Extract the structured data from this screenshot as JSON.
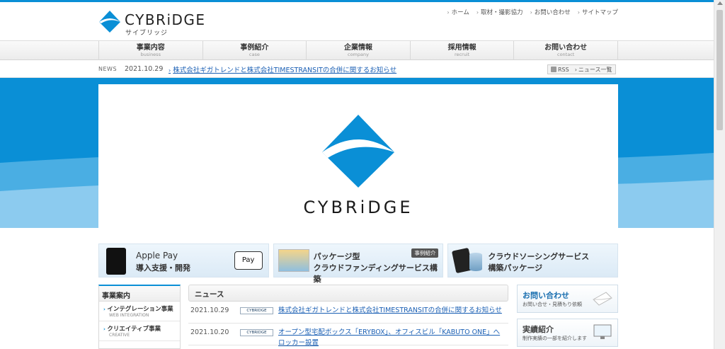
{
  "header": {
    "logo_text": "CYBRiDGE",
    "logo_sub": "サイブリッジ",
    "util_nav": [
      "ホーム",
      "取材・撮影協力",
      "お問い合わせ",
      "サイトマップ"
    ]
  },
  "gnav": [
    {
      "jp": "事業内容",
      "en": "business"
    },
    {
      "jp": "事例紹介",
      "en": "case"
    },
    {
      "jp": "企業情報",
      "en": "company"
    },
    {
      "jp": "採用情報",
      "en": "recruit"
    },
    {
      "jp": "お問い合わせ",
      "en": "contact"
    }
  ],
  "newsbar": {
    "label": "NEWS",
    "date": "2021.10.29",
    "title": "株式会社ギガトレンドと株式会社TIMESTRANSITの合併に関するお知らせ",
    "rss": "RSS",
    "list": "ニュース一覧"
  },
  "hero": {
    "logo_text": "CYBRiDGE"
  },
  "banners": {
    "b1": {
      "line1": "Apple Pay",
      "line2": "導入支援・開発",
      "pay": " Pay"
    },
    "b2": {
      "line1": "パッケージ型",
      "line2": "クラウドファンディングサービス構築",
      "tag": "事例紹介"
    },
    "b3": {
      "line1": "クラウドソーシングサービス",
      "line2": "構築パッケージ"
    }
  },
  "sidebar": {
    "title": "事業案内",
    "items": [
      {
        "jp": "インテグレーション事業",
        "en": "WEB INTEGRATION"
      },
      {
        "jp": "クリエイティブ事業",
        "en": "CREATIVE"
      }
    ]
  },
  "news": {
    "title": "ニュース",
    "category_label": "CYBRIDGE",
    "items": [
      {
        "date": "2021.10.29",
        "title": "株式会社ギガトレンドと株式会社TIMESTRANSITの合併に関するお知らせ"
      },
      {
        "date": "2021.10.20",
        "title": "オープン型宅配ボックス「ERYBOX」、オフィスビル「KABUTO ONE」へロッカー設置"
      }
    ]
  },
  "right": {
    "contact": {
      "title": "お問い合わせ",
      "sub": "お問い合せ・見積もり依頼"
    },
    "works": {
      "title": "実績紹介",
      "sub": "制作実績の一部を紹介します"
    }
  },
  "colors": {
    "accent": "#0a8fd6"
  }
}
